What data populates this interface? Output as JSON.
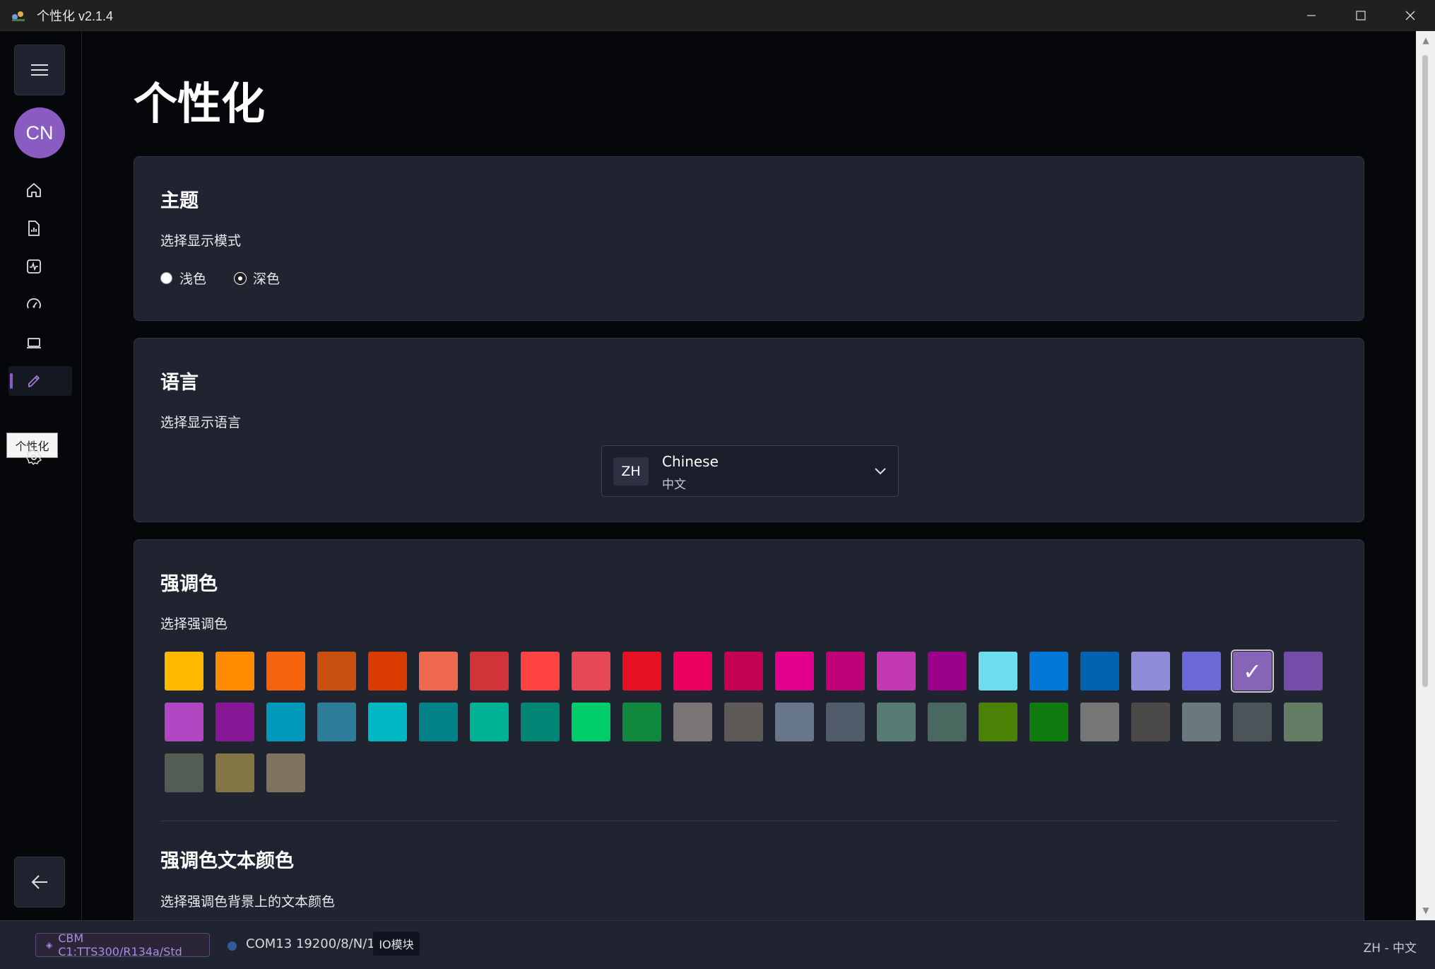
{
  "window": {
    "title": "个性化 v2.1.4"
  },
  "sidebar": {
    "avatar_initials": "CN",
    "nav_items": [
      {
        "name": "home-icon"
      },
      {
        "name": "report-icon"
      },
      {
        "name": "activity-icon"
      },
      {
        "name": "gauge-icon"
      },
      {
        "name": "laptop-icon"
      },
      {
        "name": "brush-icon",
        "active": true
      },
      {
        "name": "gear-icon"
      }
    ],
    "tooltip": "个性化"
  },
  "page": {
    "title": "个性化"
  },
  "theme": {
    "title": "主题",
    "subtitle": "选择显示模式",
    "options": [
      {
        "label": "浅色",
        "checked": false
      },
      {
        "label": "深色",
        "checked": true
      }
    ]
  },
  "language": {
    "title": "语言",
    "subtitle": "选择显示语言",
    "selected": {
      "code": "ZH",
      "name": "Chinese",
      "native": "中文"
    }
  },
  "accent": {
    "title": "强调色",
    "subtitle": "选择强调色",
    "selected_index": 21,
    "colors": [
      "#FFB900",
      "#FF8C00",
      "#F7630C",
      "#CA5010",
      "#DA3B01",
      "#EF6950",
      "#D13438",
      "#FF4343",
      "#E74856",
      "#E81123",
      "#EA005E",
      "#C30052",
      "#E3008C",
      "#BF0077",
      "#C239B3",
      "#9A0089",
      "#6BDDEF",
      "#0078D7",
      "#0063B1",
      "#8E8CD8",
      "#6B69D6",
      "#8764B8",
      "#744DA9",
      "#B146C2",
      "#881798",
      "#0099BC",
      "#2D7D9A",
      "#00B7C3",
      "#038387",
      "#00B294",
      "#018574",
      "#00CC6A",
      "#10893E",
      "#7A7574",
      "#5D5A58",
      "#68768A",
      "#515C6B",
      "#567C73",
      "#486860",
      "#498205",
      "#107C10",
      "#767676",
      "#4C4A48",
      "#69797E",
      "#4A5459",
      "#647C64",
      "#525E54",
      "#847545",
      "#7E735F"
    ]
  },
  "accent_text": {
    "title": "强调色文本颜色",
    "subtitle": "选择强调色背景上的文本颜色"
  },
  "statusbar": {
    "config": "CBM C1:TTS300/R134a/Std",
    "port": "COM13 19200/8/N/1",
    "io_label": "IO模块",
    "language": "ZH - 中文"
  }
}
